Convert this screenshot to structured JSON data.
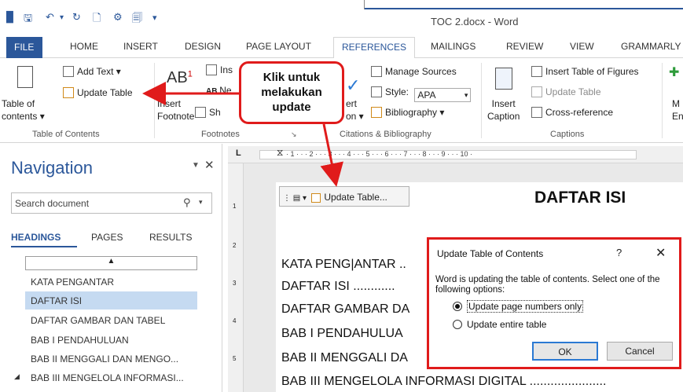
{
  "window": {
    "title": "TOC 2.docx - Word"
  },
  "tabs": [
    "FILE",
    "HOME",
    "INSERT",
    "DESIGN",
    "PAGE LAYOUT",
    "REFERENCES",
    "MAILINGS",
    "REVIEW",
    "VIEW",
    "GRAMMARLY"
  ],
  "ribbon": {
    "toc": {
      "big": "Table of\ncontents ▾",
      "add_text": "Add Text ▾",
      "update_table": "Update Table",
      "group": "Table of Contents"
    },
    "footnotes": {
      "ab": "AB",
      "sup": "1",
      "ins": "Ins",
      "ab2": "AB",
      "ne": "Ne",
      "insert_footnote": "Insert\nFootnote",
      "sh": "Sh",
      "group": "Footnotes"
    },
    "citations": {
      "manage_sources": "Manage Sources",
      "style_label": "Style:",
      "style_value": "APA",
      "bibliography": "Bibliography ▾",
      "insert_partial": "ert\non ▾",
      "group": "Citations & Bibliography"
    },
    "captions": {
      "insert_caption": "Insert\nCaption",
      "insert_table_figures": "Insert Table of Figures",
      "update_table": "Update Table",
      "cross_reference": "Cross-reference",
      "group": "Captions"
    },
    "index": {
      "partial": "M\nEn"
    }
  },
  "callout": {
    "text": "Klik untuk\nmelakukan\nupdate"
  },
  "navigation": {
    "title": "Navigation",
    "search_placeholder": "Search document",
    "tabs": [
      "HEADINGS",
      "PAGES",
      "RESULTS"
    ],
    "collapse_glyph": "▲",
    "headings": [
      "KATA PENGANTAR",
      "DAFTAR ISI",
      "DAFTAR GAMBAR DAN TABEL",
      "BAB I PENDAHULUAN",
      "BAB II MENGGALI DAN MENGO...",
      "BAB III MENGELOLA INFORMASI..."
    ],
    "selected_index": 1,
    "expand_glyph": "◢"
  },
  "ruler": {
    "marks": "· 1 · · · 2 · · · 3 · · · 4 · · · 5 · · · 6 · · · 7 · · · 8 · · · 9 · · · 10 ·"
  },
  "document": {
    "toc_control_label": "Update Table...",
    "heading": "DAFTAR ISI",
    "lines": [
      "KATA PENG|ANTAR ..",
      "DAFTAR ISI ............",
      "DAFTAR GAMBAR DA",
      "BAB I  PENDAHULUA",
      "BAB II  MENGGALI DA",
      "BAB III  MENGELOLA INFORMASI DIGITAL ......................"
    ]
  },
  "dialog": {
    "title": "Update Table of Contents",
    "help": "?",
    "close": "✕",
    "message": "Word is updating the table of contents.  Select one of the following options:",
    "options": [
      "Update page numbers only",
      "Update entire table"
    ],
    "selected_option": 0,
    "ok": "OK",
    "cancel": "Cancel"
  },
  "colors": {
    "accent": "#2b579a",
    "callout_border": "#e01b1b",
    "selected_heading": "#c5daf1"
  }
}
